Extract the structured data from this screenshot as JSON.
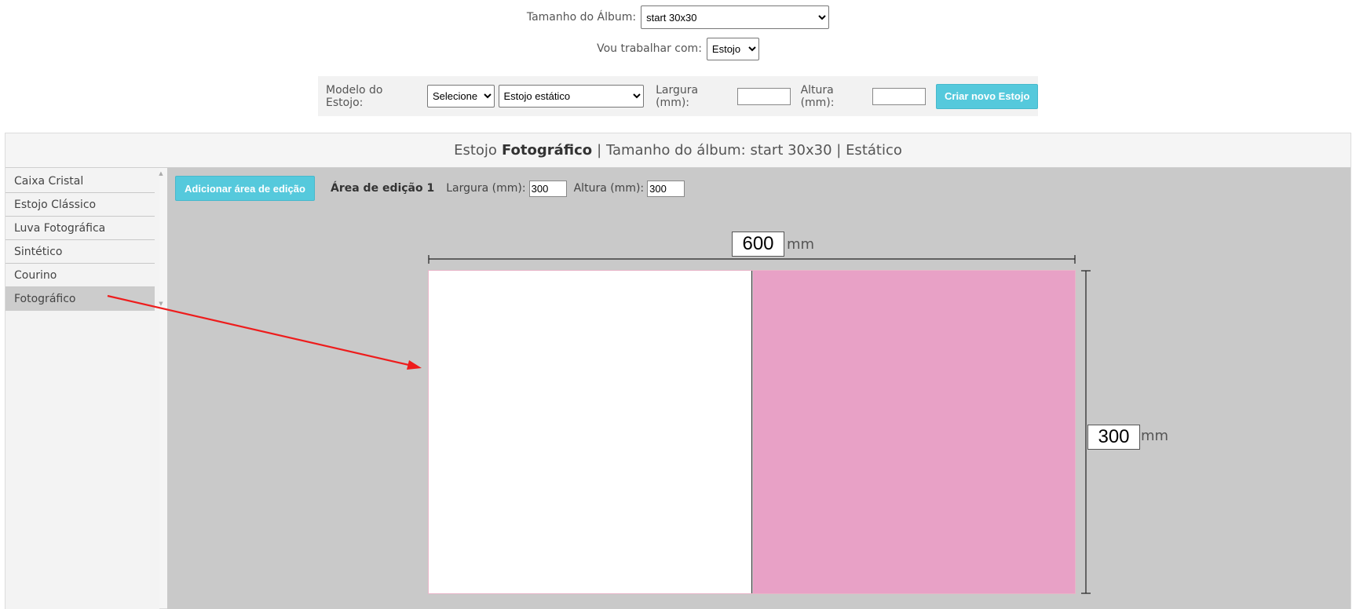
{
  "top": {
    "album_size_label": "Tamanho do Álbum:",
    "album_size_value": "start 30x30",
    "work_with_label": "Vou trabalhar com:",
    "work_with_value": "Estojo"
  },
  "model_bar": {
    "model_label": "Modelo do Estojo:",
    "model_type_value": "Selecione",
    "model_name_value": "Estojo estático",
    "width_label": "Largura (mm):",
    "width_value": "",
    "height_label": "Altura (mm):",
    "height_value": "",
    "create_button": "Criar novo Estojo"
  },
  "editor": {
    "header_prefix": "Estojo",
    "header_bold": "Fotográfico",
    "header_rest": "| Tamanho do álbum: start 30x30 | Estático",
    "sidebar_items": [
      {
        "label": "Caixa Cristal",
        "active": false
      },
      {
        "label": "Estojo Clássico",
        "active": false
      },
      {
        "label": "Luva Fotográfica",
        "active": false
      },
      {
        "label": "Sintético",
        "active": false
      },
      {
        "label": "Courino",
        "active": false
      },
      {
        "label": "Fotográfico",
        "active": true
      }
    ],
    "toolbar": {
      "add_area_button": "Adicionar área de edição",
      "area_title": "Área de edição 1",
      "width_label": "Largura (mm):",
      "width_value": "300",
      "height_label": "Altura (mm):",
      "height_value": "300"
    },
    "canvas": {
      "total_width": "600",
      "total_height": "300",
      "unit": "mm",
      "right_panel_color": "#e8a1c6",
      "left_panel_color": "#ffffff"
    }
  },
  "annotation": {
    "arrow_color": "#ee1c1c"
  }
}
